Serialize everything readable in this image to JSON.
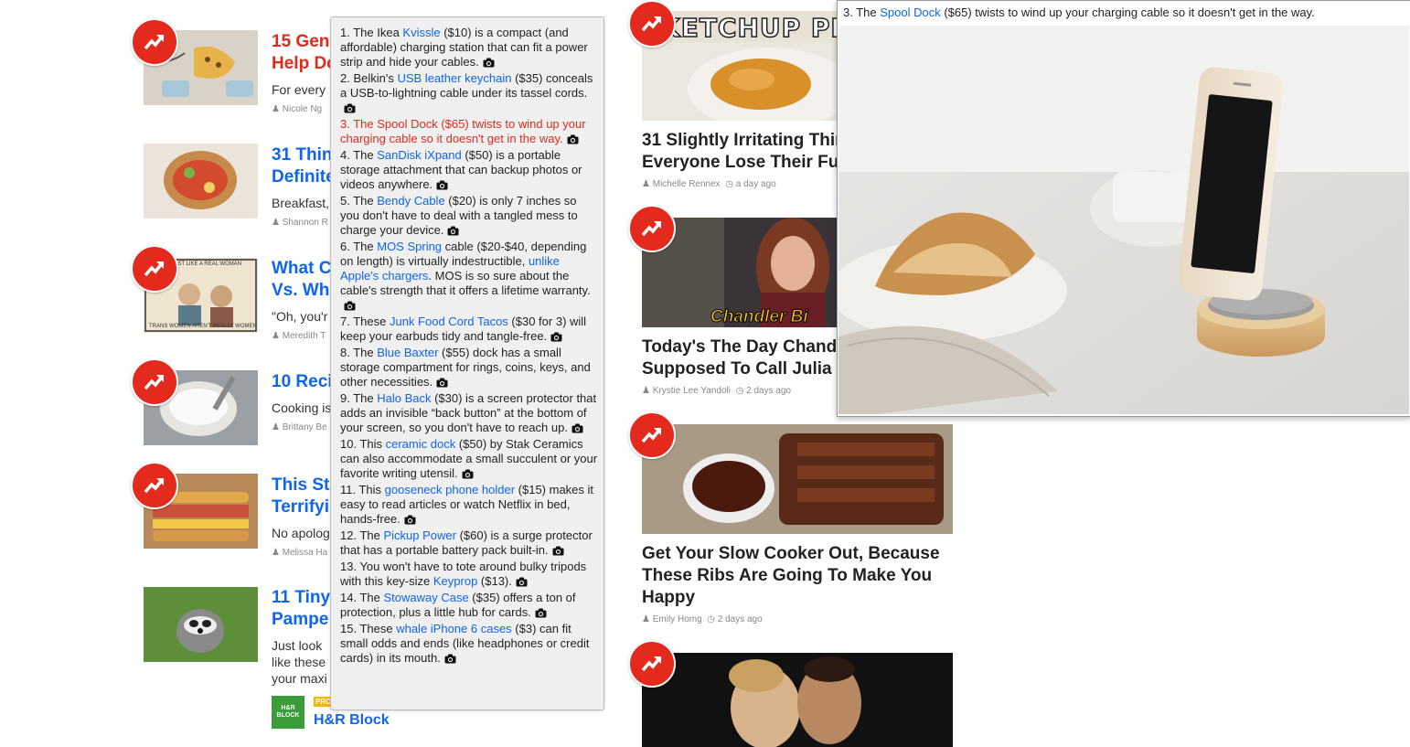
{
  "left_column": [
    {
      "title": "15 Geni",
      "title_line2": "Help Do",
      "desc": "For every",
      "author": "Nicole Ng",
      "red": true
    },
    {
      "title": "31 Thin",
      "title_line2": "Definite",
      "desc": "Breakfast,",
      "author": "Shannon R"
    },
    {
      "title": "What C",
      "title_line2": "Vs. Wha",
      "desc": "\"Oh, you'r",
      "author": "Meredith T"
    },
    {
      "title": "10 Reci",
      "title_line2": "",
      "desc": "Cooking is",
      "author": "Brittany Be"
    },
    {
      "title": "This Sto",
      "title_line2": "Terrifyi",
      "desc": "No apolog",
      "author": "Melissa Ha"
    },
    {
      "title": "11 Tiny",
      "title_line2": "Pampe",
      "desc": "Just look",
      "desc2": "like these",
      "desc3": "your maxi",
      "author": ""
    }
  ],
  "comic_text": {
    "top": "JUST LIKE A REAL WOMAN",
    "bottom": "TRANS WOMEN AREN'T REALLY WOMEN"
  },
  "sponsor": {
    "logo": "H&R BLOCK",
    "promo": "PRO",
    "name": "H&R Block"
  },
  "middle_column": [
    {
      "thumb_text": "KETCHUP PR",
      "title": "31 Slightly Irritating Thin\nEveryone Lose Their Fu",
      "author": "Michelle Rennex",
      "time": "a day ago"
    },
    {
      "thumb_text": "Chandler Bi",
      "title": "Today's The Day Chand\nSupposed To Call Julia R",
      "author": "Krystie Lee Yandoli",
      "time": "2 days ago"
    },
    {
      "title": "Get Your Slow Cooker Out, Because These Ribs Are Going To Make You Happy",
      "author": "Emily Homg",
      "time": "2 days ago"
    }
  ],
  "tooltip_items": [
    {
      "pre": "1. The Ikea ",
      "link": "Kvissle",
      "post": " ($10) is a compact (and affordable) charging station that can fit a power strip and hide your cables."
    },
    {
      "pre": "2. Belkin's ",
      "link": "USB leather keychain",
      "post": " ($35) conceals a USB-to-lightning cable under its tassel cords."
    },
    {
      "pre": "3. The ",
      "link": "Spool Dock",
      "post": " ($65) twists to wind up your charging cable so it doesn't get in the way.",
      "active": true
    },
    {
      "pre": "4. The ",
      "link": "SanDisk iXpand",
      "post": " ($50) is a portable storage attachment that can backup photos or videos anywhere."
    },
    {
      "pre": "5. The ",
      "link": "Bendy Cable",
      "post": " ($20) is only 7 inches so you don't have to deal with a tangled mess to charge your device."
    },
    {
      "pre": "6. The ",
      "link": "MOS Spring",
      "post": " cable ($20-$40, depending on length) is virtually indestructible, ",
      "link2": "unlike Apple's chargers",
      "post2": ". MOS is so sure about the cable's strength that it offers a lifetime warranty."
    },
    {
      "pre": "7. These ",
      "link": "Junk Food Cord Tacos",
      "post": " ($30 for 3) will keep your earbuds tidy and tangle-free."
    },
    {
      "pre": "8. The ",
      "link": "Blue Baxter",
      "post": " ($55) dock has a small storage compartment for rings, coins, keys, and other necessities."
    },
    {
      "pre": "9. The ",
      "link": "Halo Back",
      "post": " ($30) is a screen protector that adds an invisible “back button” at the bottom of your screen, so you don't have to reach up."
    },
    {
      "pre": "10. This ",
      "link": "ceramic dock",
      "post": " ($50) by Stak Ceramics can also accommodate a small succulent or your favorite writing utensil."
    },
    {
      "pre": "11. This ",
      "link": "gooseneck phone holder",
      "post": " ($15) makes it easy to read articles or watch Netflix in bed, hands-free."
    },
    {
      "pre": "12. The ",
      "link": "Pickup Power",
      "post": " ($60) is a surge protector that has a portable battery pack built-in."
    },
    {
      "pre": "13. You won't have to tote around bulky tripods with this key-size ",
      "link": "Keyprop",
      "post": " ($13)."
    },
    {
      "pre": "14. The ",
      "link": "Stowaway Case",
      "post": " ($35) offers a ton of protection, plus a little hub for cards."
    },
    {
      "pre": "15. These ",
      "link": "whale iPhone 6 cases",
      "post": " ($3) can fit small odds and ends (like headphones or credit cards) in its mouth."
    }
  ],
  "preview": {
    "pre": "3. The ",
    "link": "Spool Dock",
    "post": " ($65) twists to wind up your charging cable so it doesn't get in the way."
  },
  "colors": {
    "badge": "#e32a1d",
    "link": "#0f65ef",
    "active": "#e32a1d"
  },
  "icons": {
    "badge": "trending-arrow-icon",
    "camera": "camera-icon",
    "author": "person-icon",
    "time": "clock-icon"
  }
}
